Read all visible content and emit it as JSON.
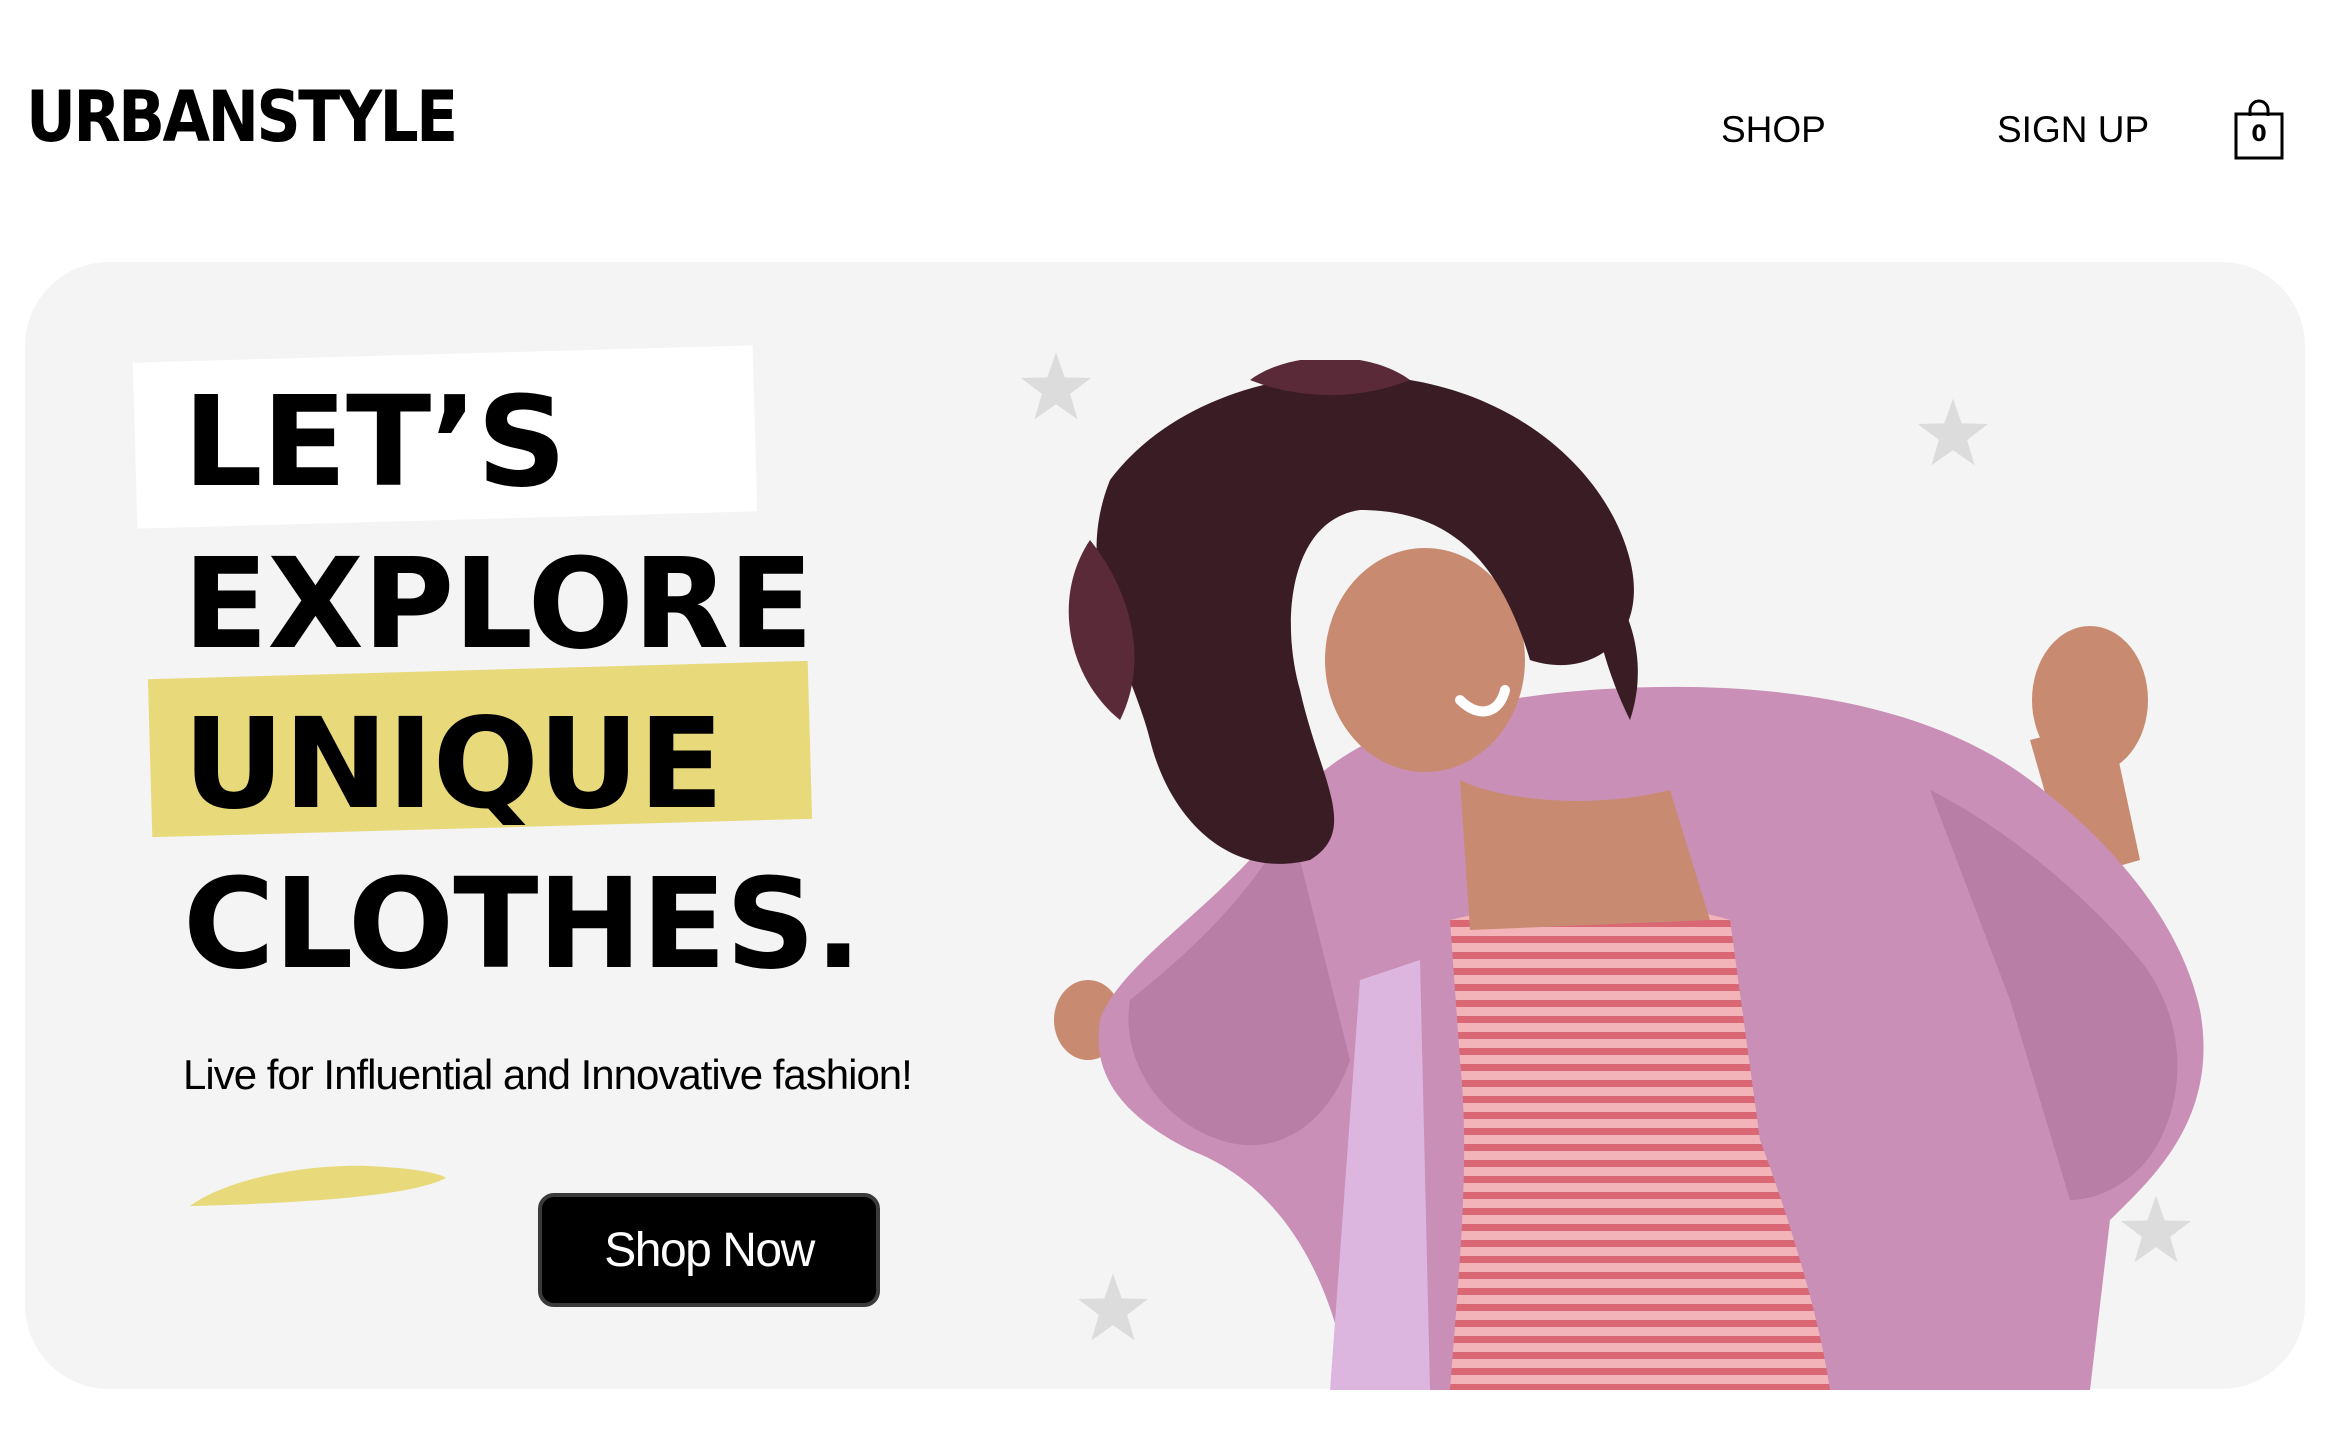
{
  "brand": {
    "logo": "URBANSTYLE"
  },
  "nav": {
    "shop": "SHOP",
    "sign_up": "SIGN UP"
  },
  "cart": {
    "count": "0",
    "icon": "shopping-bag-icon"
  },
  "hero": {
    "headline": [
      "LET’S",
      "EXPLORE",
      "UNIQUE",
      "CLOTHES."
    ],
    "subtitle": "Live for Influential and Innovative fashion!",
    "cta": "Shop Now",
    "decorations": [
      "star-icon",
      "yellow-swoosh"
    ]
  },
  "colors": {
    "background": "#ffffff",
    "hero_background": "#f3f4f3",
    "accent_yellow": "#e8d97a",
    "button": "#000000",
    "star": "#dcdcdc",
    "coat_pink": "#c98fb6"
  }
}
